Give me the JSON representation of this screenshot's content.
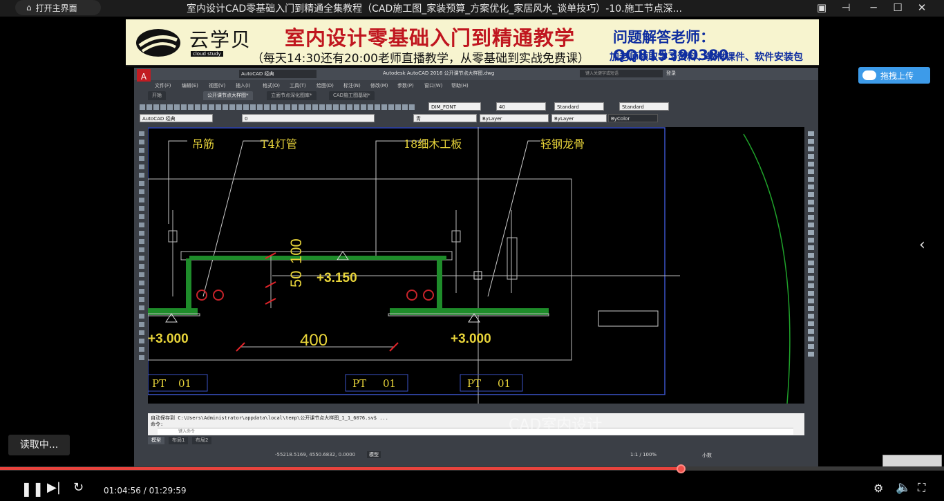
{
  "window": {
    "home_button": "打开主界面",
    "title": "室内设计CAD零基础入门到精通全集教程（CAD施工图_家装预算_方案优化_家居风水_谈单技巧）-10.施工节点深..."
  },
  "banner": {
    "logo_text": "云学贝",
    "logo_sub": "cloud study",
    "headline": "室内设计零基础入门到精通教学",
    "qq": "问题解答老师：QQ815390380",
    "subline": "（每天14:30还有20:00老师直播教学，从零基础到实战免费课）",
    "subline2": "加老师领取学习资料、教材课件、软件安装包"
  },
  "acad": {
    "workspace": "AutoCAD 经典",
    "app_title": "Autodesk AutoCAD 2016    公开课节点大样图.dwg",
    "search_placeholder": "键入关键字或短语",
    "login": "登录",
    "menus": [
      "文件(F)",
      "编辑(E)",
      "视图(V)",
      "插入(I)",
      "格式(O)",
      "工具(T)",
      "绘图(D)",
      "标注(N)",
      "修改(M)",
      "参数(P)",
      "窗口(W)",
      "帮助(H)"
    ],
    "doc_tabs": [
      "开始",
      "公开课节点大样图*",
      "立面节点深化图库*",
      "CAD施工图基础*"
    ],
    "dim_style": "DIM_FONT",
    "dim_size": "40",
    "text_style": "Standard",
    "table_style": "Standard",
    "ws_combo": "AutoCAD 经典",
    "layer": "0",
    "color": "青",
    "linetype": "ByLayer",
    "lineweight": "ByLayer",
    "plotstyle": "ByColor",
    "cmd_line1": "自动保存到 C:\\Users\\Administrator\\appdata\\local\\temp\\公开课节点大样图_1_1_6076.sv$ ...",
    "cmd_line2": "命令:",
    "cmd_placeholder": "键入命令",
    "layout_tabs": [
      "模型",
      "布局1",
      "布局2"
    ],
    "coords": "-55218.5169, 4550.6832, 0.0000",
    "model_btn": "模型",
    "scale": "1:1 / 100%",
    "anno_scale": "小数"
  },
  "drawing": {
    "labels": [
      "吊筋",
      "T4灯管",
      "18细木工板",
      "轻钢龙骨"
    ],
    "dims": [
      "50",
      "100",
      "400"
    ],
    "levels": [
      "+3.150",
      "+3.000",
      "+3.000"
    ],
    "tags": [
      "PT",
      "01",
      "PT",
      "01",
      "PT",
      "01"
    ]
  },
  "overlay": {
    "watermark": "CAD室内设计",
    "upload": "拖拽上传",
    "reading": "读取中..."
  },
  "player": {
    "time": "01:04:56 / 01:29:59",
    "progress": 0.7213
  }
}
